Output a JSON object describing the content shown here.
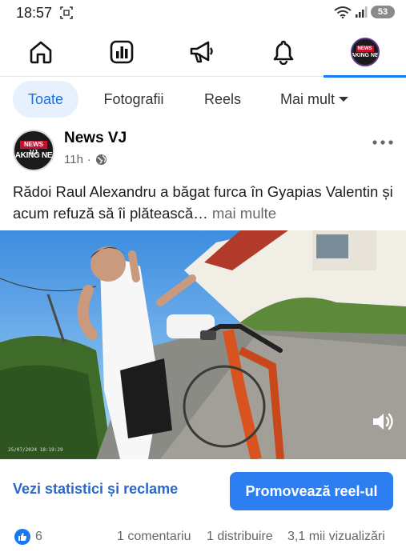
{
  "status_bar": {
    "time": "18:57",
    "battery": "53"
  },
  "nav": {
    "items": [
      "home-icon",
      "dashboard-icon",
      "megaphone-icon",
      "bell-icon",
      "profile-avatar"
    ],
    "active_index": 4,
    "avatar_logo_top": "NEWS",
    "avatar_logo_bottom": "AKING NE"
  },
  "filters": {
    "tabs": [
      "Toate",
      "Fotografii",
      "Reels",
      "Mai mult"
    ],
    "active": "Toate"
  },
  "post": {
    "page_name": "News VJ",
    "time": "11h",
    "separator": "·",
    "logo_top": "NEWS VJ",
    "logo_bottom": "AKING NE",
    "text": "Rădoi Raul Alexandru a băgat furca în Gyapias Valentin și acum refuză să îi plătească…",
    "see_more": "mai multe",
    "video_timestamp": "25/07/2024 18:19:29"
  },
  "actions": {
    "stats_link": "Vezi statistici și reclame",
    "promote_button": "Promovează reel-ul"
  },
  "counts": {
    "likes": "6",
    "comments": "1 comentariu",
    "shares": "1 distribuire",
    "views": "3,1 mii vizualizări"
  },
  "colors": {
    "accent": "#1877f2",
    "active_chip_bg": "#e7f0fd",
    "promote_bg": "#2d7ef0",
    "muted_text": "#65676b"
  }
}
